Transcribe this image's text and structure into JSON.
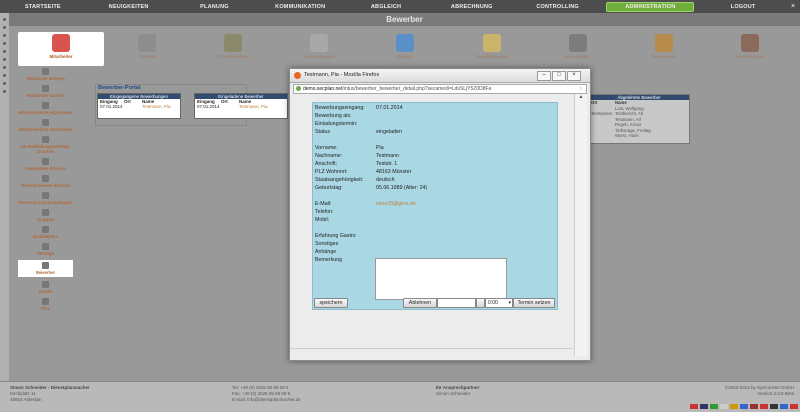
{
  "topnav": {
    "items": [
      "STARTSEITE",
      "NEUIGKEITEN",
      "PLANUNG",
      "KOMMUNIKATION",
      "ABGLEICH",
      "ABRECHNUNG",
      "CONTROLLING",
      "ADMINISTRATION",
      "LOGOUT"
    ],
    "active": "ADMINISTRATION",
    "close": "×"
  },
  "page_title": "Bewerber",
  "modules": [
    "Mitarbeiter",
    "Kunden",
    "Schnellverkauf",
    "Auswertungen",
    "Objekte",
    "Qualifikationen",
    "Einsatzplan",
    "Ressourcen",
    "Einstellungen"
  ],
  "sidebar": [
    "Mitarbeiter anlegen",
    "Mitarbeiter suchen",
    "Mitarbeiterliste exportieren",
    "Mitarbeiterliste exportieren",
    "EK-Bekleidungsaufträge drucken",
    "Dienstpläne drucken",
    "Dienstausweise drucken",
    "Personal Erfassungsbogen",
    "Gruppen",
    "Qualifikation",
    "Verträge",
    "Bewerber",
    "Details",
    "Plus"
  ],
  "portal": {
    "title": "Bewerber-Portal",
    "box1": {
      "header": "Eingegangene Bewerbungen",
      "cols": [
        "Eingang",
        "Ort",
        "Name"
      ],
      "row": [
        "07.01.2014",
        "",
        "Testmann, Pia"
      ]
    },
    "box2": {
      "header": "Eingeladene Bewerber",
      "cols": [
        "Eingang",
        "Ort",
        "Name"
      ],
      "row": [
        "07.01.2014",
        "",
        "Testmann, Pia"
      ]
    }
  },
  "rejected": {
    "header": "Abgelehnte Bewerber",
    "cols": [
      "Ort",
      "Name"
    ],
    "rows": [
      [
        "",
        "Lost, Wolfgang"
      ],
      [
        "Testsystem",
        "Testbericht, Alt"
      ],
      [
        "",
        "Testmann, Alf"
      ],
      [
        "",
        "Regeh, Kreuz"
      ],
      [
        "",
        "Tieftsnage, Freitag"
      ],
      [
        "",
        "Wurst, Hans"
      ]
    ]
  },
  "footer": {
    "company": "Simon Schneider - Dienstplanmacher",
    "street": "Kirchplatz 11",
    "city": "48653 Ahlerdan",
    "phone": "Tel: +49 (0) 2525 95 69 69 0",
    "fax": "Fax: +49 (0) 2525 95 69 69 9",
    "email_label": "E-mail: info@dienstplanmacher.de",
    "contact_title": "Ihr Ansprechpartner:",
    "contact_name": "Simon Schneider",
    "copyright": "©2002-2014 by SysConNet GmbH",
    "version": "Version 2.3.9 Beta"
  },
  "modal": {
    "window_title": "Testmann, Pia - Mozilla Firefox",
    "url_host": "demo.secplan.net",
    "url_path": "/intus/bewerber_bewerber_detail.php?secamedi=LdsSLjY5Z0D8Fa",
    "fields": [
      {
        "label": "Bewerbungseingang:",
        "value": "07.01.2014"
      },
      {
        "label": "Bewerbung als:",
        "value": ""
      },
      {
        "label": "Einladungstermin:",
        "value": ""
      },
      {
        "label": "Status",
        "value": "eingeladen"
      },
      {
        "label": "Vorname:",
        "value": "Pia"
      },
      {
        "label": "Nachname:",
        "value": "Testmann"
      },
      {
        "label": "Anschrift:",
        "value": "Teststr. 1"
      },
      {
        "label": "PLZ Wohnort:",
        "value": "48163 Münster"
      },
      {
        "label": "Staatsangehörigkeit:",
        "value": "deutsch"
      },
      {
        "label": "Geburtstag:",
        "value": "05.06.1989 (Alter: 24)"
      },
      {
        "label": "E-Mail:",
        "value": "ness33@gmx.de"
      },
      {
        "label": "Telefon:",
        "value": ""
      },
      {
        "label": "Mobil:",
        "value": ""
      },
      {
        "label": "Erfahrung Gastro",
        "value": ""
      },
      {
        "label": "Sonstiges",
        "value": ""
      },
      {
        "label": "Anhänge",
        "value": ""
      },
      {
        "label": "Bemerkung",
        "value": ""
      }
    ],
    "save_label": "speichern",
    "reject_label": "Ablehnen",
    "time_value": "0:00",
    "set_date_label": "Termin setzen"
  },
  "colors": {
    "accent_green": "#6fae3a",
    "dialog_form": "#a9d8e4",
    "header_blue": "#324c70"
  }
}
